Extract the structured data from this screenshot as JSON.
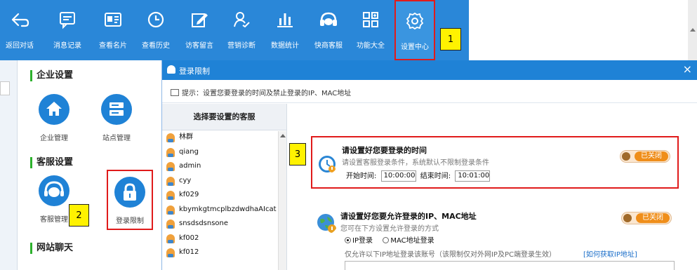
{
  "toolbar": {
    "items": [
      {
        "label": "返回对话",
        "icon": "back-arrow-icon"
      },
      {
        "label": "消息记录",
        "icon": "message-icon"
      },
      {
        "label": "查看名片",
        "icon": "id-card-icon"
      },
      {
        "label": "查看历史",
        "icon": "clock-icon"
      },
      {
        "label": "访客留言",
        "icon": "edit-icon"
      },
      {
        "label": "营销诊断",
        "icon": "diagnosis-icon"
      },
      {
        "label": "数据统计",
        "icon": "bar-chart-icon"
      },
      {
        "label": "快商客服",
        "icon": "headset-icon"
      },
      {
        "label": "功能大全",
        "icon": "grid-icon"
      },
      {
        "label": "设置中心",
        "icon": "gear-icon"
      }
    ],
    "selected_index": 9
  },
  "menu": {
    "sections": [
      {
        "title": "企业设置",
        "items": [
          {
            "label": "企业管理",
            "icon": "home-icon"
          },
          {
            "label": "站点管理",
            "icon": "server-icon"
          }
        ]
      },
      {
        "title": "客服设置",
        "items": [
          {
            "label": "客服管理",
            "icon": "agent-icon"
          },
          {
            "label": "登录限制",
            "icon": "lock-icon"
          }
        ]
      },
      {
        "title": "网站聊天",
        "items": []
      }
    ]
  },
  "dialog": {
    "title": "登录限制",
    "close": "×",
    "tip": "提示：设置您要登录的时间及禁止登录的IP、MAC地址",
    "agent_list_title": "选择要设置的客服",
    "agents": [
      "林群",
      "qiang",
      "admin",
      "cyy",
      "kf029",
      "kbymkgtmcplbzdwdhaAIcat",
      "snsdsdsnsone",
      "kf002",
      "kf012"
    ],
    "time_card": {
      "title": "请设置好您要登录的时间",
      "subtitle": "请设置客服登录条件，系统默认不限制登录条件",
      "toggle": "已关闭",
      "start_label": "开始时间:",
      "start_value": "10:00:00",
      "end_label": "结束时间:",
      "end_value": "10:01:00"
    },
    "ip_card": {
      "title": "请设置好您要允许登录的IP、MAC地址",
      "subtitle": "您可在下方设置允许登录的方式",
      "toggle": "已关闭",
      "radio_ip": "IP登录",
      "radio_mac": "MAC地址登录",
      "ip_note": "仅允许以下IP地址登录该账号（该限制仅对外网IP及PC端登录生效）",
      "ip_link": "[如何获取IP地址]"
    }
  },
  "annotations": [
    "1",
    "2",
    "3"
  ],
  "colors": {
    "toolbar_bg": "#2a87d8",
    "highlight": "#e01b1b",
    "marker_bg": "#fff200",
    "toggle_orange": "#ef8e1a"
  }
}
